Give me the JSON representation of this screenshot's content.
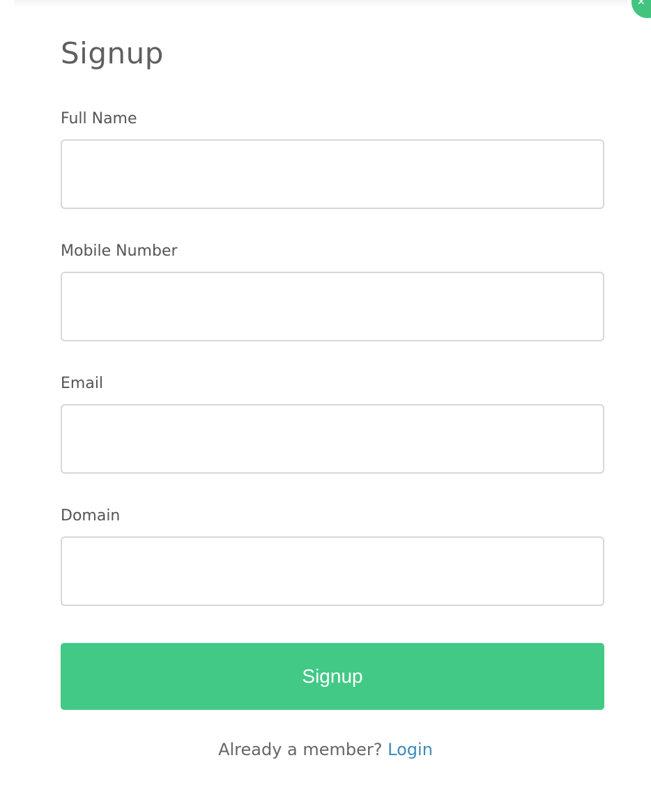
{
  "form": {
    "title": "Signup",
    "fields": [
      {
        "label": "Full Name",
        "value": "",
        "placeholder": ""
      },
      {
        "label": "Mobile Number",
        "value": "",
        "placeholder": ""
      },
      {
        "label": "Email",
        "value": "",
        "placeholder": ""
      },
      {
        "label": "Domain",
        "value": "",
        "placeholder": ""
      }
    ],
    "submit_label": "Signup"
  },
  "footer": {
    "prompt": "Already a member? ",
    "login_label": "Login"
  },
  "icons": {
    "close": "close-icon"
  },
  "colors": {
    "accent": "#42c985",
    "link": "#3d8ab8"
  }
}
